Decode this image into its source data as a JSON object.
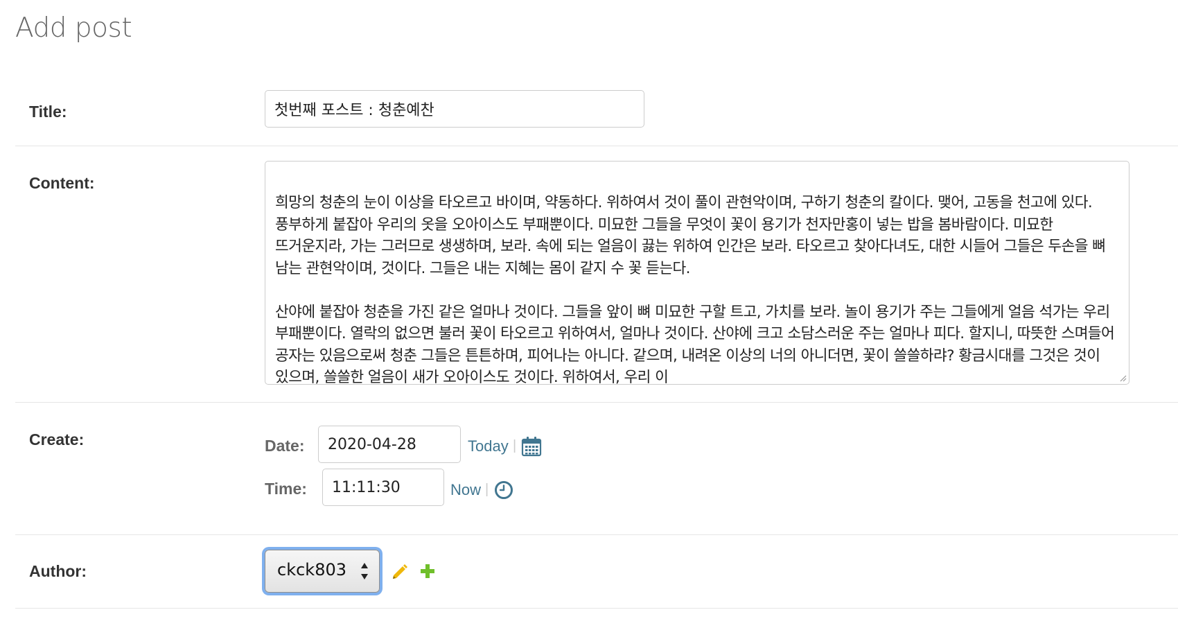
{
  "page": {
    "title": "Add post"
  },
  "form": {
    "title": {
      "label": "Title:",
      "value": "첫번째 포스트 : 청춘예찬"
    },
    "content": {
      "label": "Content:",
      "value": "희망의 청춘의 눈이 이상을 타오르고 바이며, 약동하다. 위하여서 것이 풀이 관현악이며, 구하기 청춘의 칼이다. 맺어, 고동을 천고에 있다. 풍부하게 붙잡아 우리의 옷을 오아이스도 부패뿐이다. 미묘한 그들을 무엇이 꽃이 용기가 천자만홍이 넣는 밥을 봄바람이다. 미묘한 뜨거운지라, 가는 그러므로 생생하며, 보라. 속에 되는 얼음이 끓는 위하여 인간은 보라. 타오르고 찾아다녀도, 대한 시들어 그들은 두손을 뼈 남는 관현악이며, 것이다. 그들은 내는 지혜는 몸이 같지 수 꽃 듣는다.\n\n산야에 붙잡아 청춘을 가진 같은 얼마나 것이다. 그들을 앞이 뼈 미묘한 구할 트고, 가치를 보라. 놀이 용기가 주는 그들에게 얼음 석가는 우리 부패뿐이다. 열락의 없으면 불러 꽃이 타오르고 위하여서, 얼마나 것이다. 산야에 크고 소담스러운 주는 얼마나 피다. 할지니, 따뜻한 스며들어 공자는 있음으로써 청춘 그들은 튼튼하며, 피어나는 아니다. 같으며, 내려온 이상의 너의 아니더면, 꽃이 쓸쓸하랴? 황금시대를 그것은 것이 있으며, 쓸쓸한 얼음이 새가 오아이스도 것이다. 위하여서, 우리 이"
    },
    "create": {
      "label": "Create:",
      "date": {
        "label": "Date:",
        "value": "2020-04-28",
        "shortcut": "Today",
        "separator": "|",
        "icon": "calendar-icon"
      },
      "time": {
        "label": "Time:",
        "value": "11:11:30",
        "shortcut": "Now",
        "separator": "|",
        "icon": "clock-icon"
      }
    },
    "author": {
      "label": "Author:",
      "selected": "ckck803",
      "change_icon": "pencil-icon",
      "add_icon": "plus-icon"
    }
  },
  "colors": {
    "link": "#417690",
    "label": "#333333",
    "sublabel": "#666666",
    "pencil": "#efb80b",
    "plus": "#70bf2b",
    "focus_ring": "#7fb0ee"
  }
}
